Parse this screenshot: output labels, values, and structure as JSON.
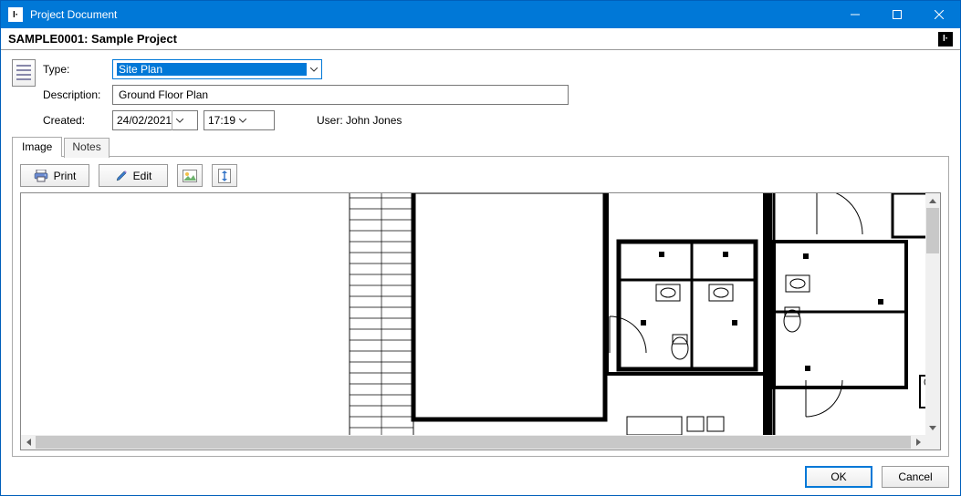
{
  "window": {
    "title": "Project Document",
    "appIconGlyph": "I·",
    "logoGlyph": "I·"
  },
  "header": {
    "title": "SAMPLE0001: Sample Project"
  },
  "form": {
    "typeLabel": "Type:",
    "typeValue": "Site Plan",
    "descLabel": "Description:",
    "descValue": "Ground Floor Plan",
    "createdLabel": "Created:",
    "dateValue": "24/02/2021",
    "timeValue": "17:19",
    "userLabel": "User:",
    "userValue": "John Jones"
  },
  "tabs": {
    "image": "Image",
    "notes": "Notes",
    "active": "image"
  },
  "toolbar": {
    "print": "Print",
    "edit": "Edit",
    "iconImgTooltip": "Image tool",
    "iconFitTooltip": "Fit"
  },
  "footer": {
    "ok": "OK",
    "cancel": "Cancel"
  }
}
